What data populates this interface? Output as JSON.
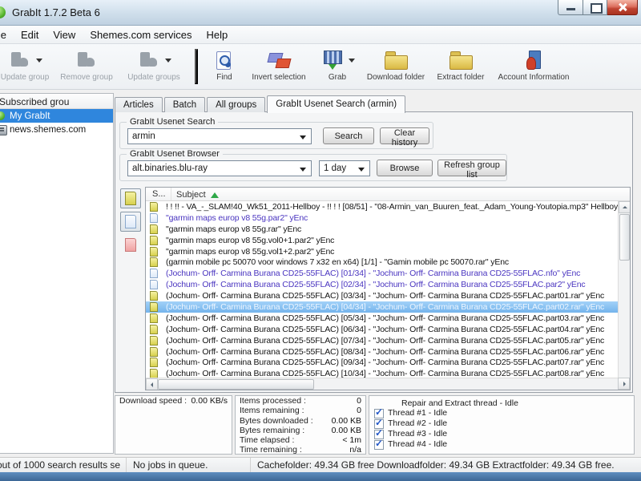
{
  "window": {
    "title": "GrabIt 1.7.2 Beta 6"
  },
  "colors": {
    "selection_blue": "#2f86dd",
    "visited_link_purple": "#4a35c0",
    "sort_arrow_green": "#2fa848",
    "close_button_red": "#c04432",
    "document_yellow": "#d7d14e"
  },
  "menu": {
    "items": [
      "File",
      "Edit",
      "View",
      "Shemes.com services",
      "Help"
    ]
  },
  "toolbar": {
    "buttons": [
      {
        "label": "Update group",
        "icon": "update-group",
        "disabled": true,
        "dropdown": true
      },
      {
        "label": "Remove group",
        "icon": "remove-group",
        "disabled": true
      },
      {
        "label": "Update groups",
        "icon": "update-groups",
        "disabled": true,
        "dropdown": true
      },
      {
        "sep": true
      },
      {
        "label": "Find",
        "icon": "find"
      },
      {
        "label": "Invert selection",
        "icon": "invert-selection"
      },
      {
        "label": "Grab",
        "icon": "grab",
        "dropdown": true
      },
      {
        "label": "Download folder",
        "icon": "download-folder"
      },
      {
        "label": "Extract folder",
        "icon": "extract-folder"
      },
      {
        "label": "Account Information",
        "icon": "account-information"
      }
    ]
  },
  "sidebar": {
    "header": "Subscribed grou",
    "items": [
      {
        "label": "My GrabIt",
        "icon": "grabit",
        "selected": true
      },
      {
        "label": "news.shemes.com",
        "icon": "server",
        "selected": false
      }
    ]
  },
  "tabs": {
    "items": [
      "Articles",
      "Batch",
      "All groups",
      "GrabIt Usenet Search (armin)"
    ],
    "active_index": 3
  },
  "search_box": {
    "title": "GrabIt Usenet Search",
    "query": "armin",
    "search_label": "Search",
    "clear_label": "Clear history"
  },
  "browser_box": {
    "title": "GrabIt Usenet Browser",
    "group": "alt.binaries.blu-ray",
    "period": "1 day",
    "browse_label": "Browse",
    "refresh_label": "Refresh group list"
  },
  "list": {
    "columns": [
      "S...",
      "Subject"
    ],
    "sort": "ascending",
    "filters": [
      {
        "name": "filter-archive-files-button",
        "style": "yellow",
        "pressed": true
      },
      {
        "name": "filter-par-files-button",
        "style": "blue",
        "pressed": true
      },
      {
        "name": "filter-incomplete-files-button",
        "style": "red",
        "pressed": false
      }
    ],
    "rows": [
      {
        "icon": "yellow",
        "style": "n",
        "text": "! ! !! - VA_-_SLAM!40_Wk51_2011-Hellboy - !! ! ! [08/51] - \"08-Armin_van_Buuren_feat._Adam_Young-Youtopia.mp3\" Hellboy"
      },
      {
        "icon": "blue",
        "style": "v",
        "text": "\"garmin maps europ v8 55g.par2\" yEnc"
      },
      {
        "icon": "yellow",
        "style": "n",
        "text": "\"garmin maps europ v8 55g.rar\" yEnc"
      },
      {
        "icon": "yellow",
        "style": "n",
        "text": "\"garmin maps europ v8 55g.vol0+1.par2\" yEnc"
      },
      {
        "icon": "yellow",
        "style": "n",
        "text": "\"garmin maps europ v8 55g.vol1+2.par2\" yEnc"
      },
      {
        "icon": "yellow",
        "style": "n",
        "text": "(garmin mobile pc 50070 voor windows 7 x32 en x64) [1/1] - \"Gamin mobile pc 50070.rar\" yEnc"
      },
      {
        "icon": "blue",
        "style": "v",
        "text": "(Jochum- Orff- Carmina Burana CD25-55FLAC) [01/34] - \"Jochum- Orff- Carmina Burana CD25-55FLAC.nfo\" yEnc"
      },
      {
        "icon": "blue",
        "style": "v",
        "text": "(Jochum- Orff- Carmina Burana CD25-55FLAC) [02/34] - \"Jochum- Orff- Carmina Burana CD25-55FLAC.par2\" yEnc"
      },
      {
        "icon": "yellow",
        "style": "n",
        "text": "(Jochum- Orff- Carmina Burana CD25-55FLAC) [03/34] - \"Jochum- Orff- Carmina Burana CD25-55FLAC.part01.rar\" yEnc"
      },
      {
        "icon": "yellow",
        "style": "sel",
        "text": "(Jochum- Orff- Carmina Burana CD25-55FLAC) [04/34] - \"Jochum- Orff- Carmina Burana CD25-55FLAC.part02.rar\" yEnc"
      },
      {
        "icon": "yellow",
        "style": "n",
        "text": "(Jochum- Orff- Carmina Burana CD25-55FLAC) [05/34] - \"Jochum- Orff- Carmina Burana CD25-55FLAC.part03.rar\" yEnc"
      },
      {
        "icon": "yellow",
        "style": "n",
        "text": "(Jochum- Orff- Carmina Burana CD25-55FLAC) [06/34] - \"Jochum- Orff- Carmina Burana CD25-55FLAC.part04.rar\" yEnc"
      },
      {
        "icon": "yellow",
        "style": "n",
        "text": "(Jochum- Orff- Carmina Burana CD25-55FLAC) [07/34] - \"Jochum- Orff- Carmina Burana CD25-55FLAC.part05.rar\" yEnc"
      },
      {
        "icon": "yellow",
        "style": "n",
        "text": "(Jochum- Orff- Carmina Burana CD25-55FLAC) [08/34] - \"Jochum- Orff- Carmina Burana CD25-55FLAC.part06.rar\" yEnc"
      },
      {
        "icon": "yellow",
        "style": "n",
        "text": "(Jochum- Orff- Carmina Burana CD25-55FLAC) [09/34] - \"Jochum- Orff- Carmina Burana CD25-55FLAC.part07.rar\" yEnc"
      },
      {
        "icon": "yellow",
        "style": "n",
        "text": "(Jochum- Orff- Carmina Burana CD25-55FLAC) [10/34] - \"Jochum- Orff- Carmina Burana CD25-55FLAC.part08.rar\" yEnc"
      }
    ]
  },
  "download_panel": {
    "label": "Download speed :",
    "value": "0.00 KB/s"
  },
  "stats_panel": {
    "rows": [
      {
        "label": "Items processed :",
        "value": "0"
      },
      {
        "label": "Items remaining :",
        "value": "0"
      },
      {
        "label": "Bytes downloaded :",
        "value": "0.00 KB"
      },
      {
        "label": "Bytes remaining :",
        "value": "0.00 KB"
      },
      {
        "label": "Time elapsed :",
        "value": "< 1m"
      },
      {
        "label": "Time remaining :",
        "value": "n/a"
      }
    ]
  },
  "threads_panel": {
    "title": "Repair and Extract thread - Idle",
    "threads": [
      {
        "label": "Thread #1 - Idle",
        "checked": true
      },
      {
        "label": "Thread #2 - Idle",
        "checked": true
      },
      {
        "label": "Thread #3 - Idle",
        "checked": true
      },
      {
        "label": "Thread #4 - Idle",
        "checked": true
      }
    ]
  },
  "statusbar": {
    "cells": [
      "out of 1000 search results se",
      "No jobs in queue.",
      "Cachefolder: 49.34 GB free  Downloadfolder: 49.34 GB  Extractfolder: 49.34 GB free."
    ]
  }
}
